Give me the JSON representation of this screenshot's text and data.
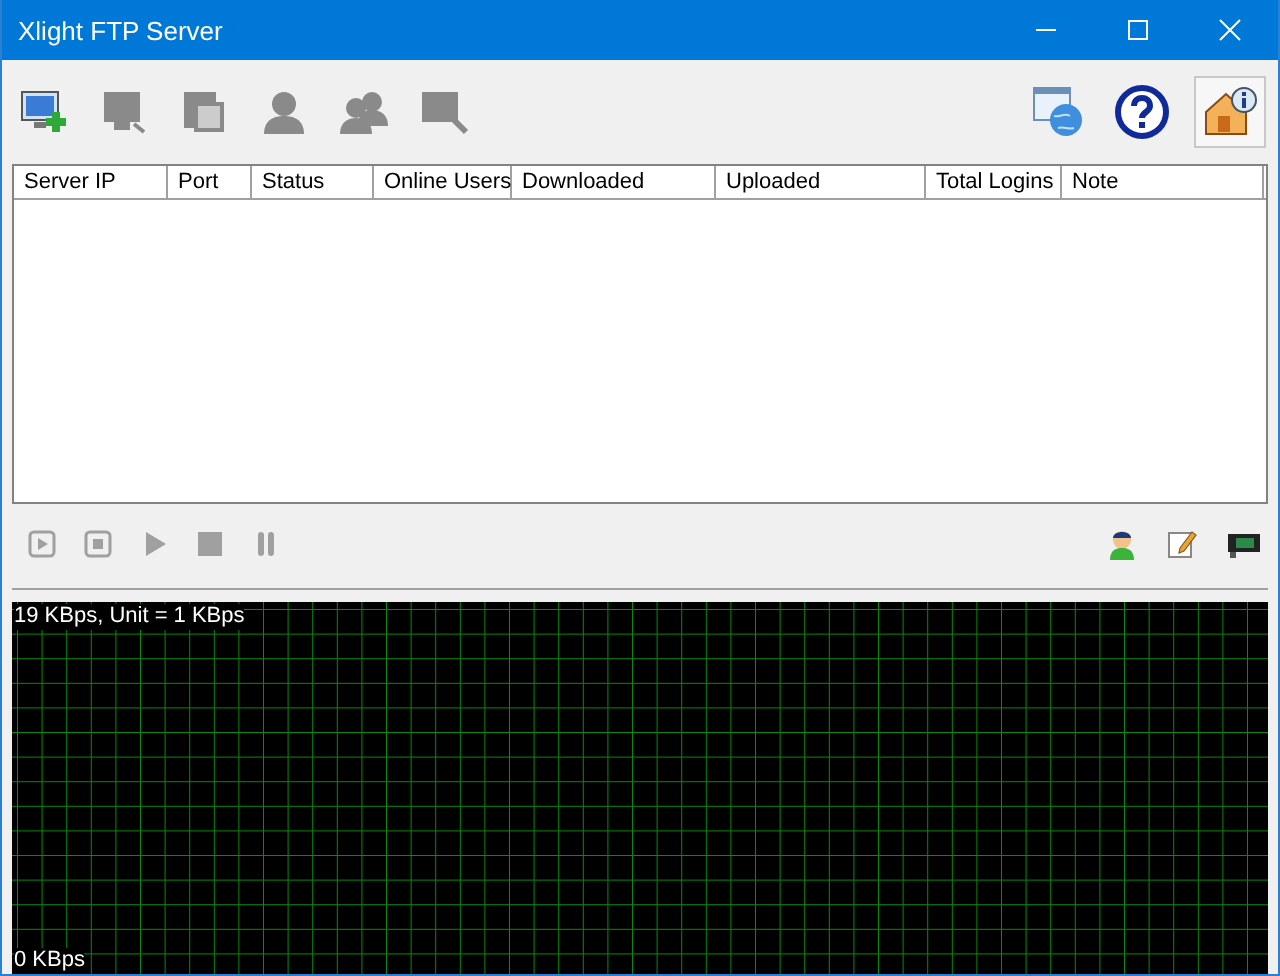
{
  "window": {
    "title": "Xlight FTP Server"
  },
  "toolbar": [
    {
      "kind": "add-server",
      "disabled": false
    },
    {
      "kind": "server",
      "disabled": true
    },
    {
      "kind": "edit",
      "disabled": true
    },
    {
      "kind": "user",
      "disabled": true
    },
    {
      "kind": "users",
      "disabled": true
    },
    {
      "kind": "search",
      "disabled": true
    }
  ],
  "toolbar_right": [
    {
      "kind": "web"
    },
    {
      "kind": "help"
    },
    {
      "kind": "about"
    }
  ],
  "table": {
    "columns": [
      {
        "label": "Server IP"
      },
      {
        "label": "Port"
      },
      {
        "label": "Status"
      },
      {
        "label": "Online Users"
      },
      {
        "label": "Downloaded"
      },
      {
        "label": "Uploaded"
      },
      {
        "label": "Total Logins"
      },
      {
        "label": "Note"
      }
    ]
  },
  "controls": [
    {
      "kind": "start-box",
      "disabled": true
    },
    {
      "kind": "stop-box",
      "disabled": true
    },
    {
      "kind": "play",
      "disabled": true
    },
    {
      "kind": "stop",
      "disabled": true
    },
    {
      "kind": "pause",
      "disabled": true
    }
  ],
  "controls_right": [
    {
      "kind": "user"
    },
    {
      "kind": "note"
    },
    {
      "kind": "card"
    }
  ],
  "graph": {
    "top_label": "19 KBps, Unit = 1 KBps",
    "bottom_label": "0 KBps"
  }
}
